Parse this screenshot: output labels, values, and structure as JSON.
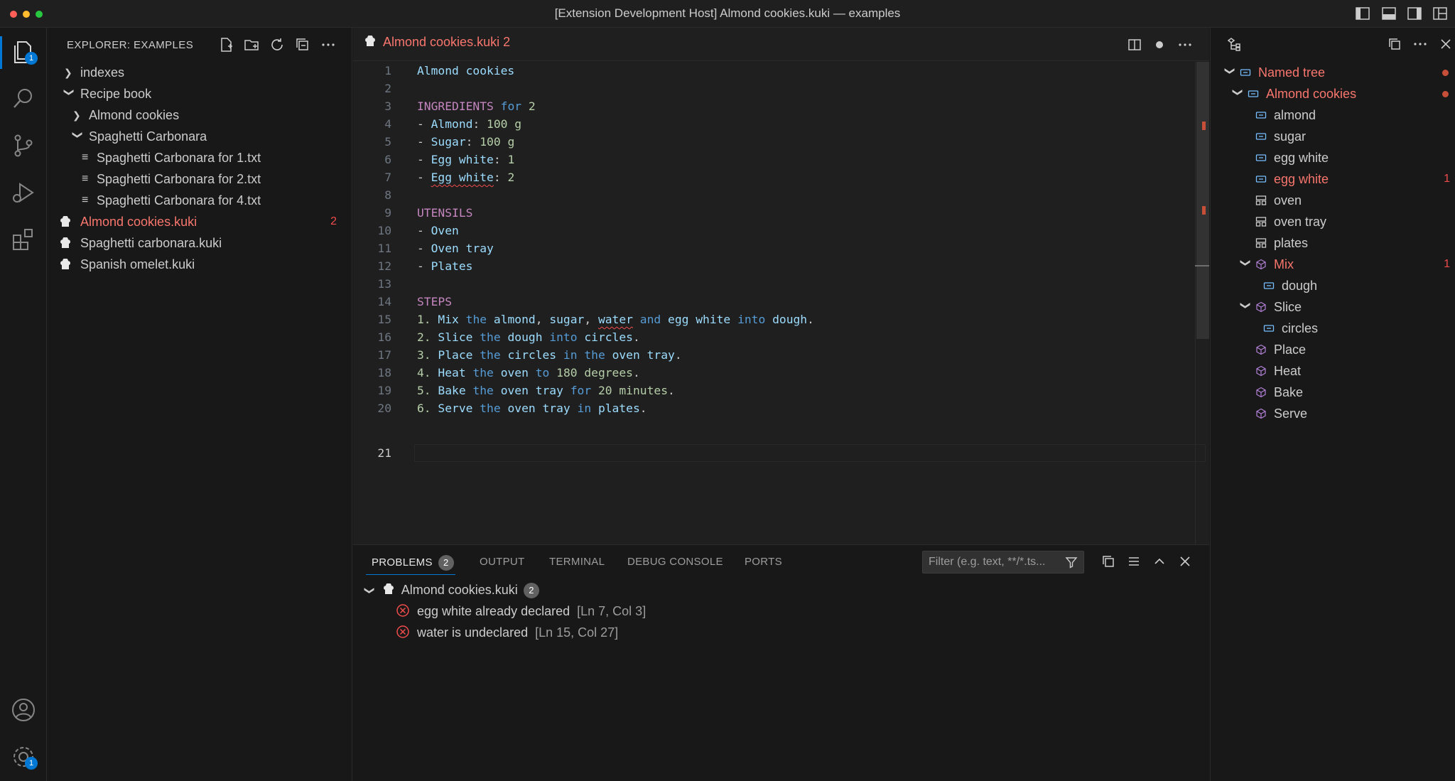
{
  "window": {
    "title": "[Extension Development Host] Almond cookies.kuki — examples"
  },
  "activity_bar": {
    "explorer_badge": "1",
    "settings_badge": "1"
  },
  "explorer": {
    "header": "EXPLORER: EXAMPLES",
    "items": [
      {
        "label": "indexes",
        "kind": "folder-collapsed"
      },
      {
        "label": "Recipe book",
        "kind": "folder-expanded"
      },
      {
        "label": "Almond cookies",
        "kind": "folder-collapsed"
      },
      {
        "label": "Spaghetti Carbonara",
        "kind": "folder-expanded"
      },
      {
        "label": "Spaghetti Carbonara for 1.txt",
        "kind": "text-file"
      },
      {
        "label": "Spaghetti Carbonara for 2.txt",
        "kind": "text-file"
      },
      {
        "label": "Spaghetti Carbonara for 4.txt",
        "kind": "text-file"
      },
      {
        "label": "Almond cookies.kuki",
        "kind": "kuki-file",
        "errors": "2"
      },
      {
        "label": "Spaghetti carbonara.kuki",
        "kind": "kuki-file"
      },
      {
        "label": "Spanish omelet.kuki",
        "kind": "kuki-file"
      }
    ]
  },
  "editor": {
    "tab_label": "Almond cookies.kuki",
    "tab_errors": "2",
    "current_line": "21",
    "line_numbers": [
      "1",
      "2",
      "3",
      "4",
      "5",
      "6",
      "7",
      "8",
      "9",
      "10",
      "11",
      "12",
      "13",
      "14",
      "15",
      "16",
      "17",
      "18",
      "19",
      "20",
      "21"
    ],
    "lines": [
      "Almond cookies",
      "",
      "INGREDIENTS for 2",
      "- Almond: 100 g",
      "- Sugar: 100 g",
      "- Egg white: 1",
      "- Egg white: 2",
      "",
      "UTENSILS",
      "- Oven",
      "- Oven tray",
      "- Plates",
      "",
      "STEPS",
      "1. Mix the almond, sugar, water and egg white into dough.",
      "2. Slice the dough into circles.",
      "3. Place the circles in the oven tray.",
      "4. Heat the oven to 180 degrees.",
      "5. Bake the oven tray for 20 minutes.",
      "6. Serve the oven tray in plates.",
      ""
    ]
  },
  "panel": {
    "tabs": [
      {
        "label": "PROBLEMS",
        "badge": "2",
        "active": true
      },
      {
        "label": "OUTPUT"
      },
      {
        "label": "TERMINAL"
      },
      {
        "label": "DEBUG CONSOLE"
      },
      {
        "label": "PORTS"
      }
    ],
    "filter_placeholder": "Filter (e.g. text, **/*.ts...",
    "problem_file": "Almond cookies.kuki",
    "problem_count": "2",
    "problems": [
      {
        "message": "egg white already declared",
        "location": "[Ln 7, Col 3]"
      },
      {
        "message": "water is undeclared",
        "location": "[Ln 15, Col 27]"
      }
    ]
  },
  "outline": {
    "items": [
      {
        "label": "Named tree",
        "icon": "variable-icon",
        "error": true
      },
      {
        "label": "Almond cookies",
        "icon": "variable-icon",
        "error": true
      },
      {
        "label": "almond",
        "icon": "variable-icon"
      },
      {
        "label": "sugar",
        "icon": "variable-icon"
      },
      {
        "label": "egg white",
        "icon": "variable-icon"
      },
      {
        "label": "egg white",
        "icon": "variable-icon",
        "error": true,
        "count": "1"
      },
      {
        "label": "oven",
        "icon": "struct-icon"
      },
      {
        "label": "oven tray",
        "icon": "struct-icon"
      },
      {
        "label": "plates",
        "icon": "struct-icon"
      },
      {
        "label": "Mix",
        "icon": "method-icon",
        "error": true,
        "count": "1"
      },
      {
        "label": "dough",
        "icon": "variable-icon"
      },
      {
        "label": "Slice",
        "icon": "method-icon"
      },
      {
        "label": "circles",
        "icon": "variable-icon"
      },
      {
        "label": "Place",
        "icon": "method-icon"
      },
      {
        "label": "Heat",
        "icon": "method-icon"
      },
      {
        "label": "Bake",
        "icon": "method-icon"
      },
      {
        "label": "Serve",
        "icon": "method-icon"
      }
    ]
  },
  "colors": {
    "accent": "#0078d4",
    "error": "#f14c4c",
    "error_label": "#f8766d",
    "keyword": "#569cd6",
    "heading": "#c586c0",
    "identifier": "#9cdcfe",
    "number": "#b5cea8"
  }
}
